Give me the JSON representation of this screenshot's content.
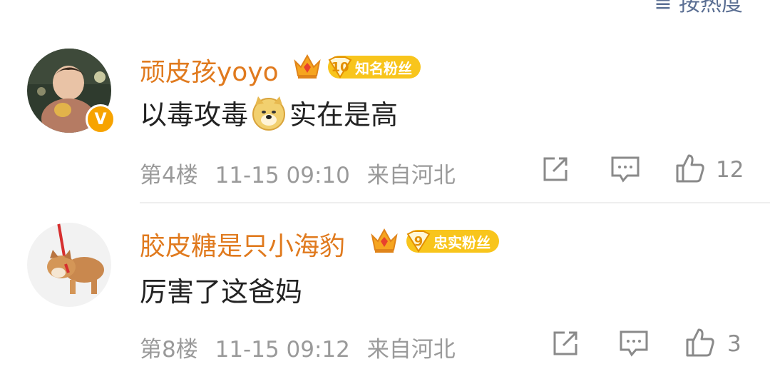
{
  "header": {
    "sort_label": "≡ 按热度"
  },
  "comments": [
    {
      "username": "顽皮孩yoyo",
      "fan_level": "10",
      "fan_label": "知名粉丝",
      "text_before": "以毒攻毒",
      "emoji": "doge-emoji",
      "text_after": "实在是高",
      "floor": "第4楼",
      "time": "11-15 09:10",
      "location": "来自河北",
      "likes": "12"
    },
    {
      "username": "胶皮糖是只小海豹",
      "fan_level": "9",
      "fan_label": "忠实粉丝",
      "text": "厉害了这爸妈",
      "floor": "第8楼",
      "time": "11-15 09:12",
      "location": "来自河北",
      "likes": "3"
    }
  ],
  "colors": {
    "username": "#e07a1e",
    "badge": "#f8c51c",
    "meta": "#9a9a9a",
    "text": "#222222",
    "verify": "#f7a300"
  }
}
